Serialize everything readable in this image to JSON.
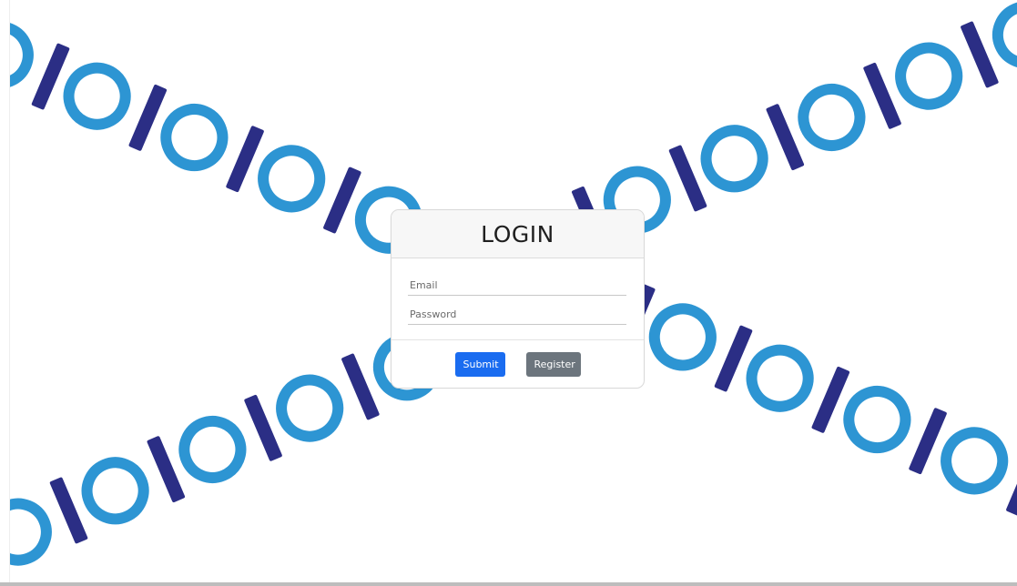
{
  "login": {
    "title": "LOGIN",
    "email_placeholder": "Email",
    "email_value": "",
    "password_placeholder": "Password",
    "password_value": "",
    "submit_label": "Submit",
    "register_label": "Register"
  },
  "background": {
    "pattern": "IO",
    "bar_color": "#2b2e85",
    "ring_color": "#2d95d3"
  },
  "colors": {
    "submit_button": "#1a6cf0",
    "register_button": "#6c757d",
    "card_header": "#f7f7f7"
  }
}
